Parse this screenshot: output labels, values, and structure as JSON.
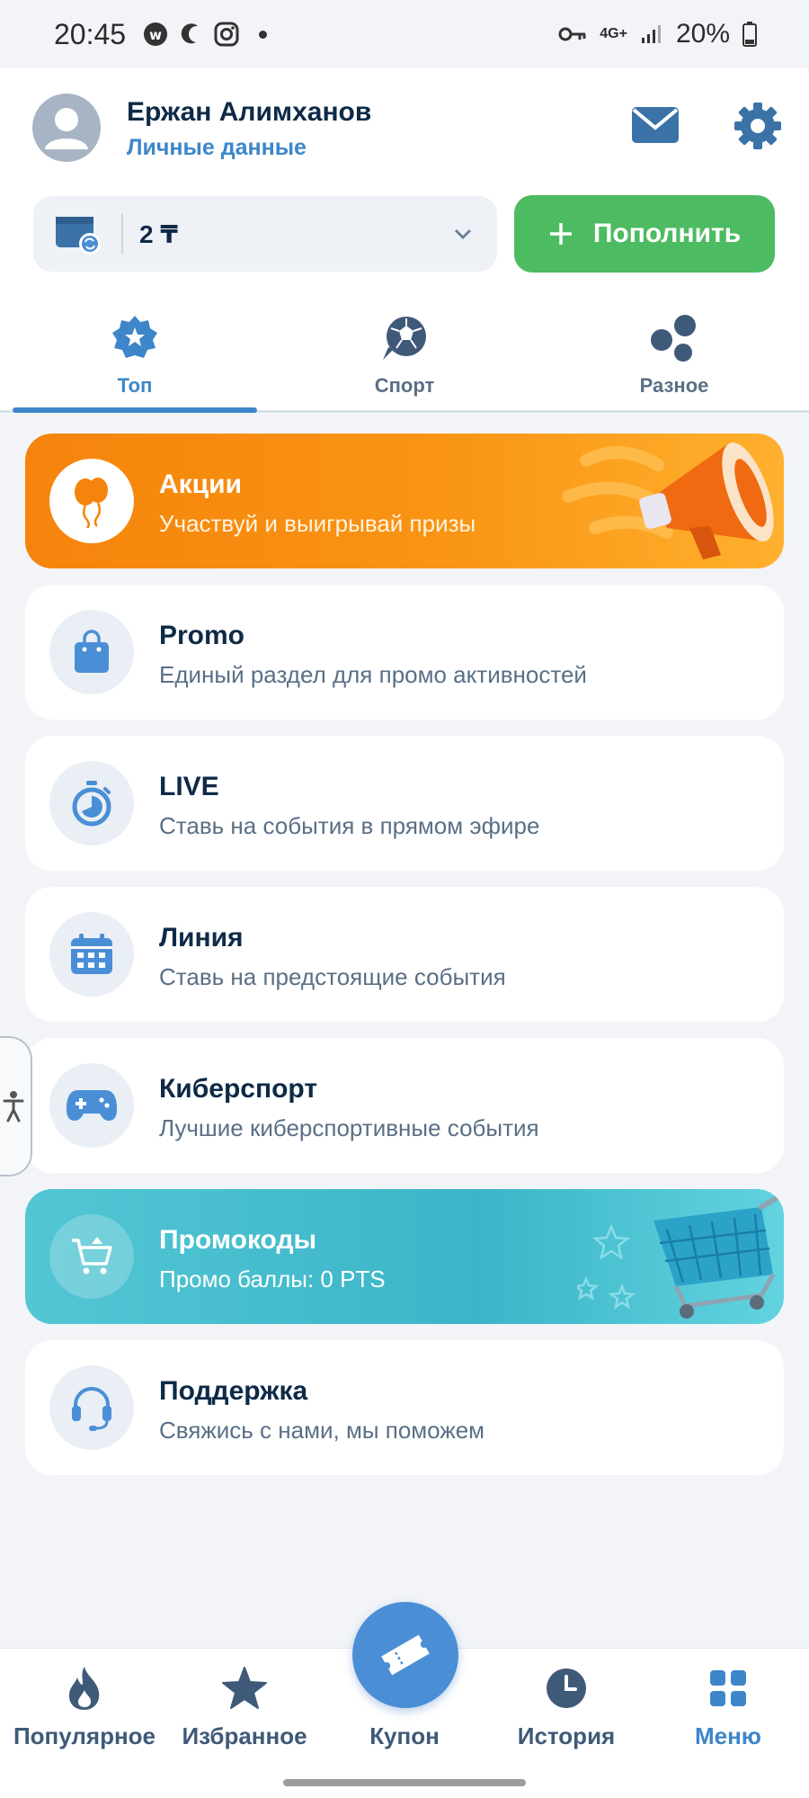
{
  "status_bar": {
    "time": "20:45",
    "network": "4G+",
    "battery": "20%"
  },
  "user": {
    "name": "Ержан Алимханов",
    "link": "Личные данные"
  },
  "balance": {
    "amount": "2 ₸"
  },
  "topup": {
    "label": "Пополнить"
  },
  "tabs": [
    {
      "label": "Топ",
      "active": true
    },
    {
      "label": "Спорт",
      "active": false
    },
    {
      "label": "Разное",
      "active": false
    }
  ],
  "cards": [
    {
      "title": "Акции",
      "subtitle": "Участвуй и выигрывай призы",
      "icon": "balloons-icon"
    },
    {
      "title": "Promo",
      "subtitle": "Единый раздел для промо активностей",
      "icon": "shopping-bag-icon"
    },
    {
      "title": "LIVE",
      "subtitle": "Ставь на события в прямом эфире",
      "icon": "stopwatch-icon"
    },
    {
      "title": "Линия",
      "subtitle": "Ставь на предстоящие события",
      "icon": "calendar-icon"
    },
    {
      "title": "Киберспорт",
      "subtitle": "Лучшие киберспортивные события",
      "icon": "gamepad-icon"
    },
    {
      "title": "Промокоды",
      "subtitle": "Промо баллы: 0 PTS",
      "icon": "cart-icon"
    },
    {
      "title": "Поддержка",
      "subtitle": "Свяжись с нами, мы поможем",
      "icon": "headset-icon"
    }
  ],
  "bottom_nav": [
    {
      "label": "Популярное",
      "icon": "fire-icon"
    },
    {
      "label": "Избранное",
      "icon": "star-icon"
    },
    {
      "label": "Купон",
      "icon": "ticket-icon"
    },
    {
      "label": "История",
      "icon": "clock-icon"
    },
    {
      "label": "Меню",
      "icon": "grid-icon",
      "active": true
    }
  ],
  "colors": {
    "accent": "#3d86c9",
    "green": "#4dbb61",
    "orange": "#f5840c",
    "teal": "#3bb5c8",
    "dark_text": "#0e2a47",
    "muted_text": "#5a6f86"
  }
}
